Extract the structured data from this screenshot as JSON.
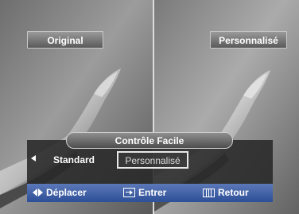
{
  "panels": {
    "left_label": "Original",
    "right_label": "Personnalisé"
  },
  "menu": {
    "title": "Contrôle Facile",
    "options": [
      "Standard",
      "Personnalisé"
    ],
    "selected_index": 1
  },
  "footer": {
    "move_label": "Déplacer",
    "enter_label": "Entrer",
    "return_label": "Retour"
  },
  "colors": {
    "footer_bar": "#3a5ba3",
    "menu_background": "#282828",
    "text": "#ffffff"
  }
}
